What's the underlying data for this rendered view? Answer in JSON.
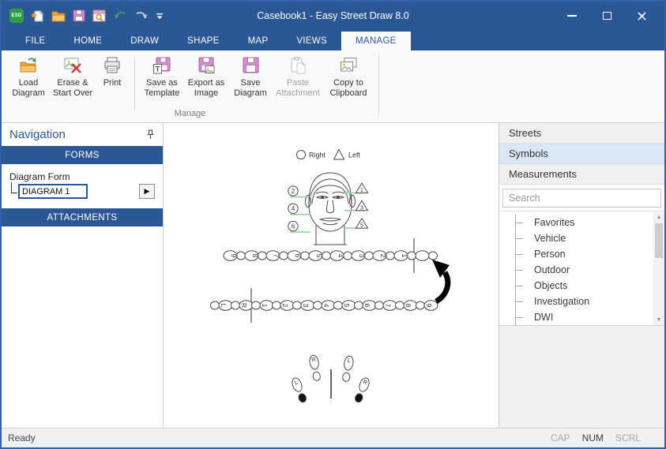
{
  "titlebar": {
    "title": "Casebook1 - Easy Street Draw 8.0",
    "app_badge": "ESD"
  },
  "tabs": [
    {
      "label": "FILE",
      "active": false
    },
    {
      "label": "HOME",
      "active": false
    },
    {
      "label": "DRAW",
      "active": false
    },
    {
      "label": "SHAPE",
      "active": false
    },
    {
      "label": "MAP",
      "active": false
    },
    {
      "label": "VIEWS",
      "active": false
    },
    {
      "label": "MANAGE",
      "active": true
    }
  ],
  "ribbon": {
    "group_label": "Manage",
    "buttons": [
      {
        "label": "Load Diagram",
        "enabled": true
      },
      {
        "label": "Erase & Start Over",
        "enabled": true
      },
      {
        "label": "Print",
        "enabled": true
      },
      {
        "label": "Save as Template",
        "enabled": true
      },
      {
        "label": "Export as Image",
        "enabled": true
      },
      {
        "label": "Save Diagram",
        "enabled": true
      },
      {
        "label": "Paste Attachment",
        "enabled": false
      },
      {
        "label": "Copy to Clipboard",
        "enabled": true
      }
    ]
  },
  "navigation": {
    "title": "Navigation",
    "forms_header": "FORMS",
    "attachments_header": "ATTACHMENTS",
    "form_label": "Diagram Form",
    "form_value": "DIAGRAM 1",
    "next_button_glyph": "▶"
  },
  "symbols_panel": {
    "headers": [
      {
        "label": "Streets",
        "selected": false
      },
      {
        "label": "Symbols",
        "selected": true
      },
      {
        "label": "Measurements",
        "selected": false
      }
    ],
    "search_placeholder": "Search",
    "tree_items": [
      "Favorites",
      "Vehicle",
      "Person",
      "Outdoor",
      "Objects",
      "Investigation",
      "DWI"
    ]
  },
  "canvas": {
    "legend": [
      {
        "shape": "circle",
        "label": "Right"
      },
      {
        "shape": "triangle",
        "label": "Left"
      }
    ],
    "injury_markers": {
      "circle_labels": [
        "2",
        "4",
        "6"
      ],
      "triangle_labels": [
        "1",
        "3",
        "5"
      ]
    },
    "walk_line_top": [
      "9",
      "8",
      "7",
      "6",
      "5",
      "4",
      "3",
      "2",
      "1",
      ""
    ],
    "walk_line_bottom": [
      "L",
      "R",
      "1",
      "2",
      "3",
      "4",
      "5",
      "6",
      "7",
      "8",
      "9"
    ],
    "feet": [
      {
        "label": "R",
        "filled_heel": false
      },
      {
        "label": "L",
        "filled_heel": true
      },
      {
        "label": "L",
        "filled_heel": false
      },
      {
        "label": "R",
        "filled_heel": true
      }
    ]
  },
  "statusbar": {
    "status": "Ready",
    "indicators": [
      {
        "label": "CAP",
        "active": false
      },
      {
        "label": "NUM",
        "active": true
      },
      {
        "label": "SCRL",
        "active": false
      }
    ]
  },
  "colors": {
    "titlebar_blue": "#2b5797",
    "marker_green": "#8fd88f",
    "floppy_pink": "#d092cc"
  }
}
